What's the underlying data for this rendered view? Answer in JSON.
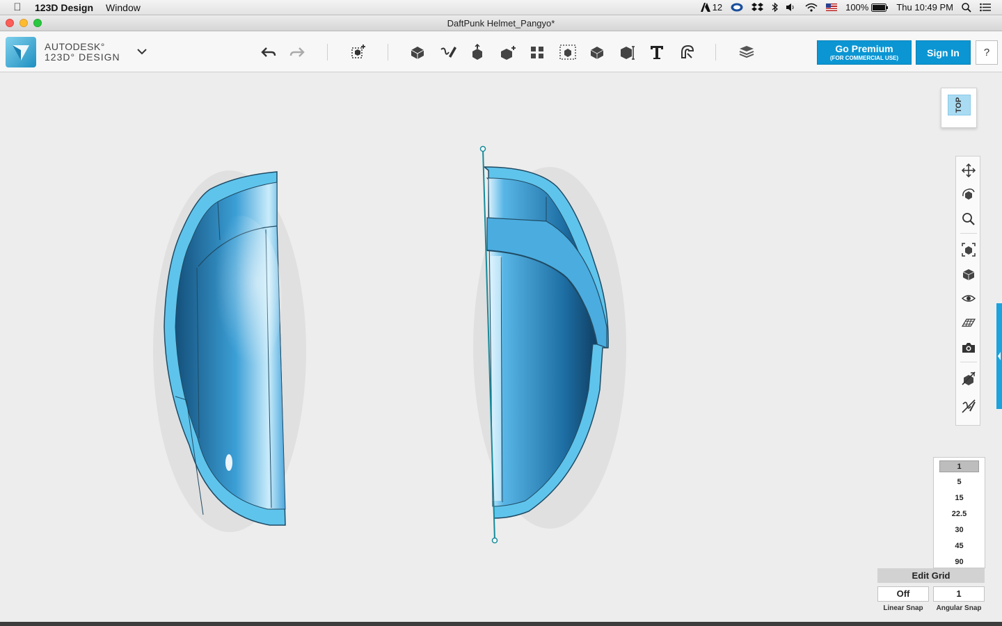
{
  "menubar": {
    "app_name": "123D Design",
    "items": [
      "Window"
    ],
    "status": {
      "adobe_count": "12",
      "battery": "100%",
      "clock": "Thu 10:49 PM"
    }
  },
  "window": {
    "title": "DaftPunk Helmet_Pangyo*"
  },
  "brand": {
    "line1": "AUTODESK°",
    "line2": "123D° DESIGN"
  },
  "toolbar": {
    "premium_label": "Go Premium",
    "premium_sub": "(FOR COMMERCIAL USE)",
    "signin_label": "Sign In",
    "help_label": "?"
  },
  "viewcube": {
    "face_label": "TOP"
  },
  "snap": {
    "angles": [
      "1",
      "5",
      "15",
      "22.5",
      "30",
      "45",
      "90"
    ],
    "selected_angle": "1",
    "edit_grid_label": "Edit Grid",
    "linear_value": "Off",
    "angular_value": "1",
    "linear_caption": "Linear Snap",
    "angular_caption": "Angular Snap"
  },
  "colors": {
    "accent": "#0b96d3",
    "model_rim": "#5fc4ec",
    "model_body": "#2f8dc4",
    "viewport_bg": "#ededed"
  }
}
